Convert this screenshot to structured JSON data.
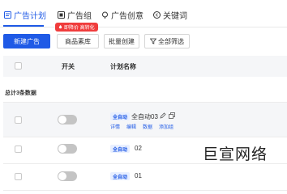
{
  "tabs": [
    {
      "label": "广告计划",
      "icon": "ad-plan-icon",
      "active": true
    },
    {
      "label": "广告组",
      "icon": "ad-group-icon",
      "active": false
    },
    {
      "label": "广告创意",
      "icon": "creative-icon",
      "active": false
    },
    {
      "label": "关键词",
      "icon": "keyword-icon",
      "active": false
    }
  ],
  "promo_badge": "即降价 高转化",
  "toolbar": {
    "new_ad": "新建广告",
    "product_library": "商品素库",
    "batch_create": "批量创建",
    "all_filter": "全部筛选"
  },
  "table": {
    "col_switch": "开关",
    "col_plan_name": "计划名称"
  },
  "summary": "总计3条数据",
  "rows": [
    {
      "tag": "全自动",
      "name": "全自动03",
      "actions": [
        "详情",
        "编辑",
        "数据",
        "添加组"
      ],
      "enabled": false
    },
    {
      "tag": "全自动",
      "name": "02",
      "enabled": false
    },
    {
      "tag": "全自动",
      "name": "01",
      "enabled": false
    }
  ],
  "watermark": "巨宣网络",
  "colors": {
    "accent": "#1f5ae6",
    "badge": "#f03c3c"
  }
}
